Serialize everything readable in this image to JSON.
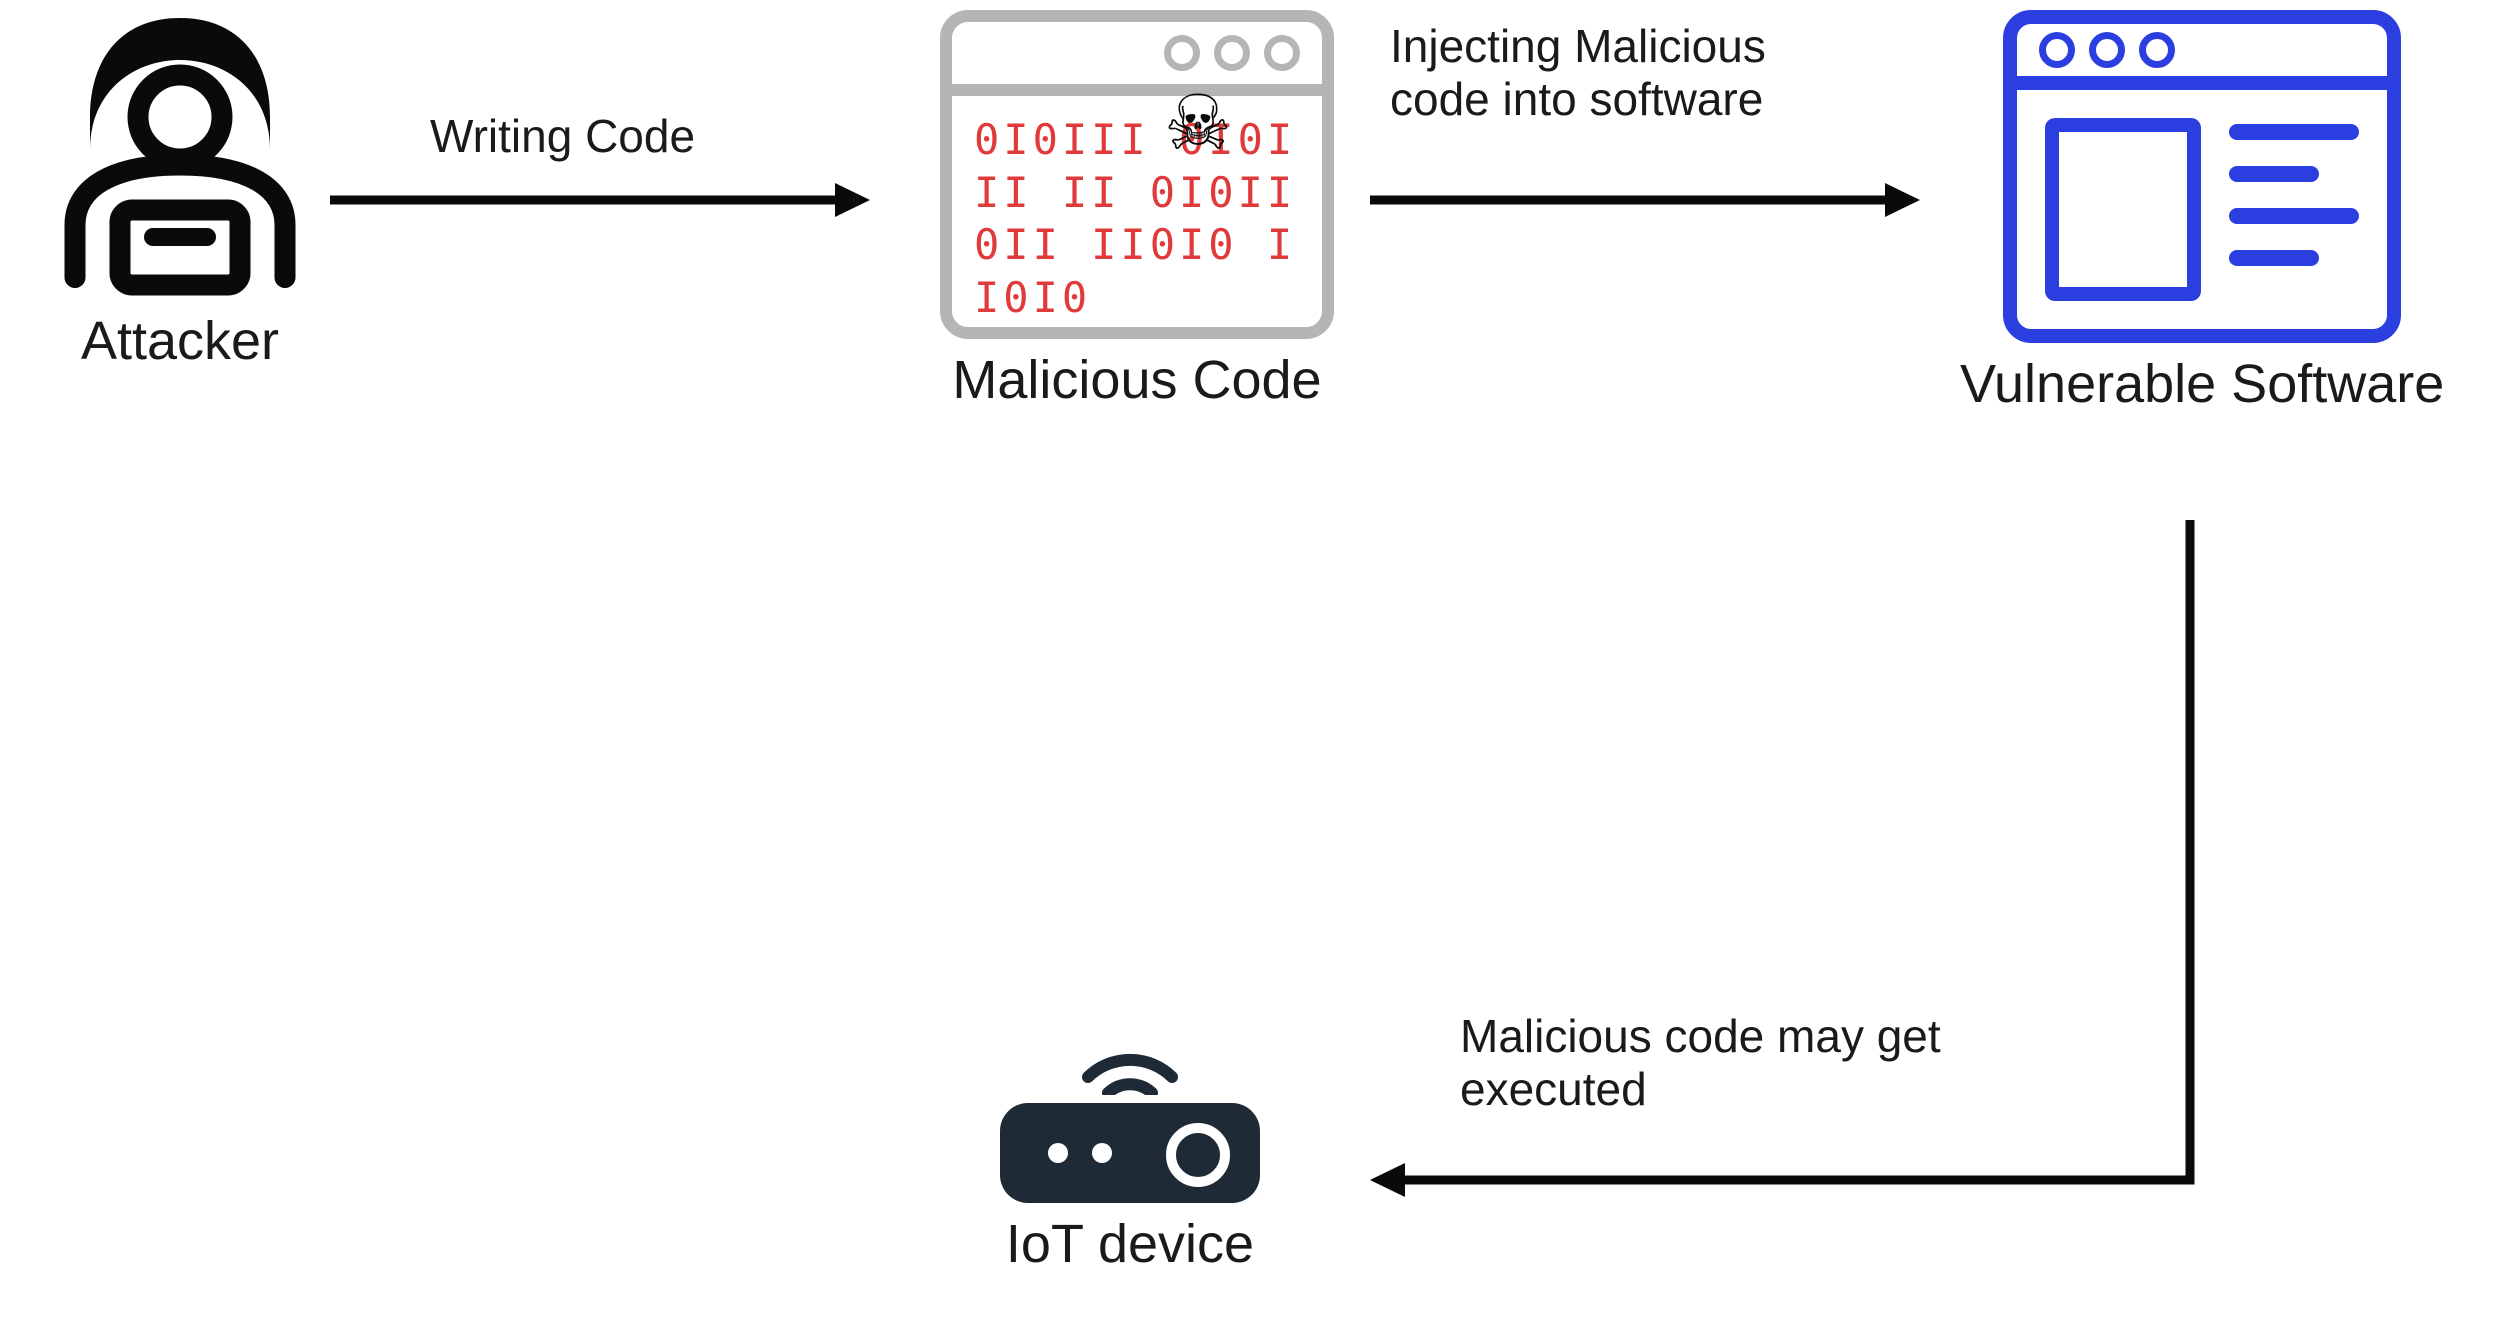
{
  "nodes": {
    "attacker": {
      "label": "Attacker"
    },
    "malicious_code": {
      "label": "Malicious Code",
      "binary_text": "0I0III 0I0III II 0I0II 0II II0I0 II0I0"
    },
    "vulnerable_software": {
      "label": "Vulnerable Software"
    },
    "iot_device": {
      "label": "IoT device"
    }
  },
  "edges": {
    "attacker_to_malicious": {
      "label": "Writing Code"
    },
    "malicious_to_software": {
      "label_line1": "Injecting Malicious",
      "label_line2": "code into software"
    },
    "software_to_iot": {
      "label_line1": "Malicious code may get",
      "label_line2": "executed"
    }
  },
  "icons": {
    "attacker": "hooded-hacker-icon",
    "malicious_window": "malicious-code-window-icon",
    "skull": "skull-icon",
    "software_window": "software-window-icon",
    "iot": "iot-router-icon"
  },
  "colors": {
    "black": "#0a0a0a",
    "gray_frame": "#b5b5b5",
    "code_red": "#e03a3a",
    "software_blue": "#2b3fe0",
    "iot_dark": "#1f2a37"
  }
}
